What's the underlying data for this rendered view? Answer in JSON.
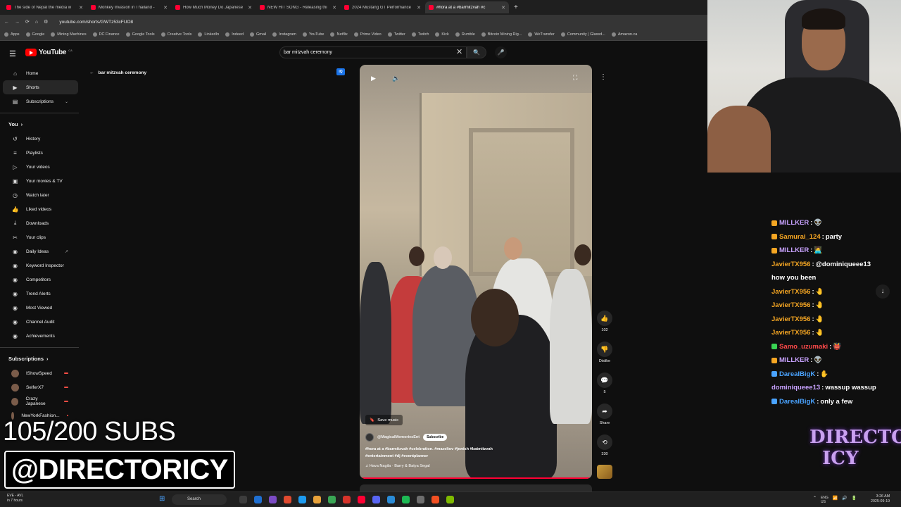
{
  "browser": {
    "tabs": [
      {
        "title": "The side of Nepal the media w",
        "active": false
      },
      {
        "title": "Monkey Invasion in Thailand -",
        "active": false
      },
      {
        "title": "How Much Money Do Japanese",
        "active": false
      },
      {
        "title": "NEW HIT SONG - Releasing thi",
        "active": false
      },
      {
        "title": "2024 Mustang GT Performance",
        "active": false
      },
      {
        "title": "#hora at a #barmitzvah #c",
        "active": true
      }
    ],
    "url": "youtube.com/shorts/GWTz53cFUO8",
    "bookmarks": [
      "Apps",
      "Google",
      "Mining Machines",
      "DC Finance",
      "Google Tools",
      "Creative Tools",
      "LinkedIn",
      "Indeed",
      "Gmail",
      "Instagram",
      "YouTube",
      "Netflix",
      "Prime Video",
      "Twitter",
      "Twitch",
      "Kick",
      "Rumble",
      "Bitcoin Mining Rig...",
      "WeTransfer",
      "Community | Glassd...",
      "Amazon.ca"
    ]
  },
  "youtube": {
    "logo_text": "YouTube",
    "logo_country": "CA",
    "search_value": "bar mitzvah ceremony",
    "back_label": "bar mitzvah ceremony",
    "sidebar": {
      "main": [
        {
          "label": "Home",
          "icon": "home-icon"
        },
        {
          "label": "Shorts",
          "icon": "shorts-icon",
          "active": true
        },
        {
          "label": "Subscriptions",
          "icon": "subscriptions-icon"
        }
      ],
      "you_heading": "You",
      "you": [
        {
          "label": "History",
          "icon": "history-icon"
        },
        {
          "label": "Playlists",
          "icon": "playlists-icon"
        },
        {
          "label": "Your videos",
          "icon": "your-videos-icon"
        },
        {
          "label": "Your movies & TV",
          "icon": "movies-icon"
        },
        {
          "label": "Watch later",
          "icon": "watch-later-icon"
        },
        {
          "label": "Liked videos",
          "icon": "liked-icon"
        },
        {
          "label": "Downloads",
          "icon": "download-icon"
        },
        {
          "label": "Your clips",
          "icon": "clips-icon"
        },
        {
          "label": "Daily Ideas",
          "icon": "tubebuddy-icon"
        },
        {
          "label": "Keyword Inspector",
          "icon": "tubebuddy-icon"
        },
        {
          "label": "Competitors",
          "icon": "tubebuddy-icon"
        },
        {
          "label": "Trend Alerts",
          "icon": "tubebuddy-icon"
        },
        {
          "label": "Most Viewed",
          "icon": "tubebuddy-icon"
        },
        {
          "label": "Channel Audit",
          "icon": "tubebuddy-icon"
        },
        {
          "label": "Achievements",
          "icon": "tubebuddy-icon"
        }
      ],
      "subs_heading": "Subscriptions",
      "subs": [
        {
          "label": "IShowSpeed"
        },
        {
          "label": "SelferX7"
        },
        {
          "label": "Crazy Japanese"
        },
        {
          "label": "NewYorkFashion..."
        }
      ]
    },
    "short": {
      "save_music": "Save music",
      "channel": "@MagicalMemoriesEnt",
      "subscribe": "Subscribe",
      "hashtags_line1": "#hora at a #barmitzvah #celebration. #mazeltov #jewish #batmitzvah",
      "hashtags_line2": "#entertainment #dj #eventplanner",
      "song": "♫ Hava Nagila · Barry & Batya Segal",
      "likes": "102",
      "dislike_label": "Dislike",
      "comments": "5",
      "share_label": "Share",
      "remix": "330"
    }
  },
  "stream": {
    "chat": [
      {
        "user": "MILLKER",
        "text": "",
        "color": "#c8a2ff",
        "badge": "#f5a623",
        "emoji": "👽"
      },
      {
        "user": "Samurai_124",
        "text": "party",
        "color": "#f5a623",
        "badge": "#f5a623",
        "emoji": ""
      },
      {
        "user": "MILLKER",
        "text": "",
        "color": "#c8a2ff",
        "badge": "#f5a623",
        "emoji": "🧑‍💻"
      },
      {
        "user": "JavierTX956",
        "text": "@dominiqueee13",
        "color": "#f5a623",
        "badge": "",
        "emoji": ""
      },
      {
        "user": "",
        "text": "how you been",
        "color": "#fff",
        "badge": "",
        "emoji": ""
      },
      {
        "user": "JavierTX956",
        "text": "",
        "color": "#f5a623",
        "badge": "",
        "emoji": "🤚"
      },
      {
        "user": "JavierTX956",
        "text": "",
        "color": "#f5a623",
        "badge": "",
        "emoji": "🤚"
      },
      {
        "user": "JavierTX956",
        "text": "",
        "color": "#f5a623",
        "badge": "",
        "emoji": "🤚"
      },
      {
        "user": "JavierTX956",
        "text": "",
        "color": "#f5a623",
        "badge": "",
        "emoji": "🤚"
      },
      {
        "user": "Samo_uzumaki",
        "text": "",
        "color": "#ff4a4a",
        "badge": "#39d353",
        "emoji": "👹"
      },
      {
        "user": "MILLKER",
        "text": "",
        "color": "#c8a2ff",
        "badge": "#f5a623",
        "emoji": "👽"
      },
      {
        "user": "DarealBigK",
        "text": "",
        "color": "#4aa3ff",
        "badge": "#4aa3ff",
        "emoji": "✋"
      },
      {
        "user": "dominiqueee13",
        "text": "wassup wassup",
        "color": "#c8a2ff",
        "badge": "",
        "emoji": ""
      },
      {
        "user": "DarealBigK",
        "text": "only a few",
        "color": "#4aa3ff",
        "badge": "#4aa3ff",
        "emoji": ""
      }
    ],
    "subs_counter": "105/200 SUBS",
    "handle": "@DIRECTORICY",
    "logo": "DIRECTOR ICY"
  },
  "taskbar": {
    "weather_line1": "EVE - AVL",
    "weather_line2": "in 7 hours",
    "search_label": "Search",
    "lang_line1": "ENG",
    "lang_line2": "US",
    "time": "3:26 AM",
    "date": "2025-09-19"
  }
}
